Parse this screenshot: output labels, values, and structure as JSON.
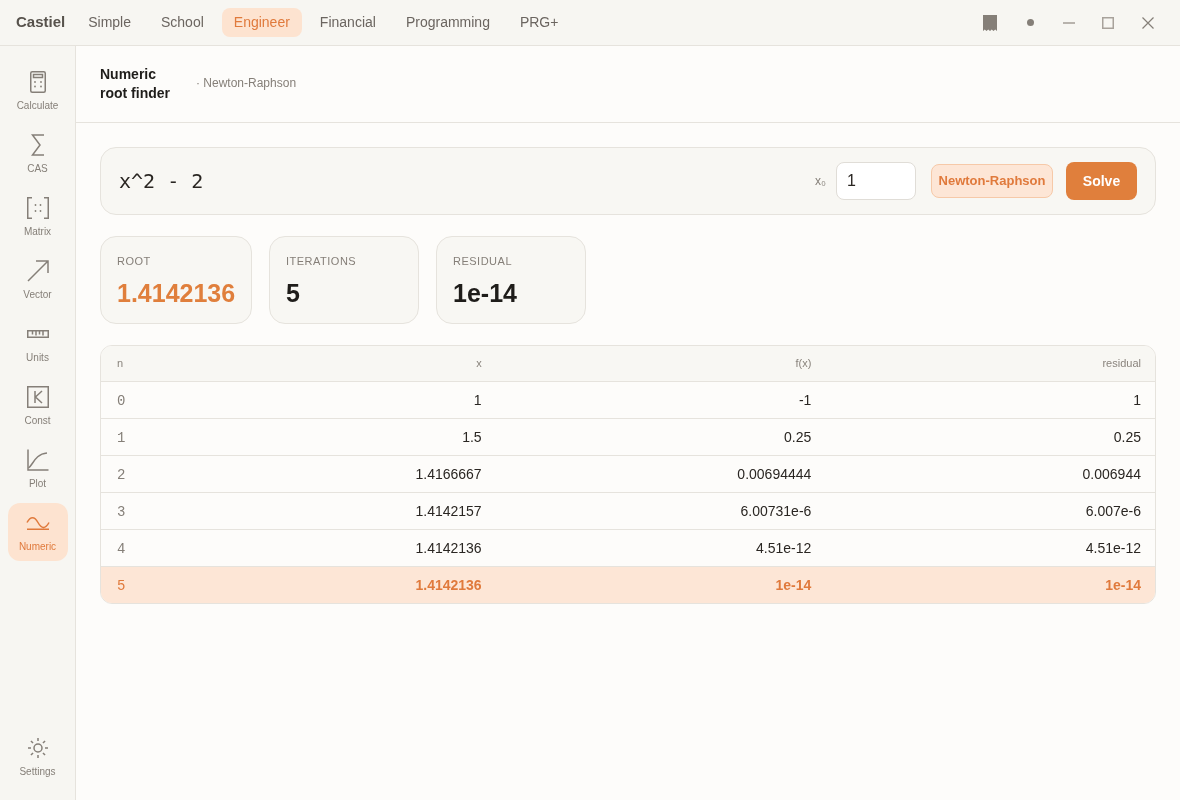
{
  "app": {
    "name": "Castiel"
  },
  "tabs": [
    {
      "label": "Simple",
      "selected": false
    },
    {
      "label": "School",
      "selected": false
    },
    {
      "label": "Engineer",
      "selected": true
    },
    {
      "label": "Financial",
      "selected": false
    },
    {
      "label": "Programming",
      "selected": false
    },
    {
      "label": "PRG+",
      "selected": false
    }
  ],
  "sidebar": {
    "items": [
      {
        "label": "Calculate",
        "selected": false
      },
      {
        "label": "CAS",
        "selected": false
      },
      {
        "label": "Matrix",
        "selected": false
      },
      {
        "label": "Vector",
        "selected": false
      },
      {
        "label": "Units",
        "selected": false
      },
      {
        "label": "Const",
        "selected": false
      },
      {
        "label": "Plot",
        "selected": false
      },
      {
        "label": "Numeric",
        "selected": true
      }
    ],
    "footer": {
      "label": "Settings"
    }
  },
  "header": {
    "title": "Numeric root finder",
    "subtitle": "· Newton-Raphson"
  },
  "solver": {
    "expression": "x^2 - 2",
    "x0_label": "x₀",
    "x0_value": "1",
    "method": "Newton-Raphson",
    "solve": "Solve"
  },
  "stats": [
    {
      "label": "ROOT",
      "value": "1.4142136",
      "highlight": true
    },
    {
      "label": "ITERATIONS",
      "value": "5",
      "highlight": false
    },
    {
      "label": "RESIDUAL",
      "value": "1e-14",
      "highlight": false
    }
  ],
  "table": {
    "columns": [
      "n",
      "x",
      "f(x)",
      "residual"
    ],
    "rows": [
      {
        "cells": [
          "0",
          "1",
          "-1",
          "1"
        ],
        "selected": false
      },
      {
        "cells": [
          "1",
          "1.5",
          "0.25",
          "0.25"
        ],
        "selected": false
      },
      {
        "cells": [
          "2",
          "1.4166667",
          "0.00694444",
          "0.006944"
        ],
        "selected": false
      },
      {
        "cells": [
          "3",
          "1.4142157",
          "6.00731e-6",
          "6.007e-6"
        ],
        "selected": false
      },
      {
        "cells": [
          "4",
          "1.4142136",
          "4.51e-12",
          "4.51e-12"
        ],
        "selected": false
      },
      {
        "cells": [
          "5",
          "1.4142136",
          "1e-14",
          "1e-14"
        ],
        "selected": true
      }
    ]
  }
}
